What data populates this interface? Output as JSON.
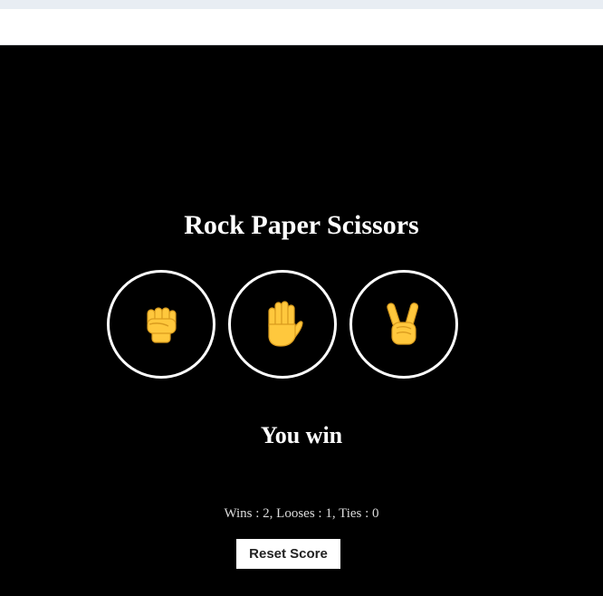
{
  "game": {
    "title": "Rock Paper Scissors",
    "choices": [
      {
        "name": "rock",
        "icon": "raised-fist-icon"
      },
      {
        "name": "paper",
        "icon": "raised-hand-icon"
      },
      {
        "name": "scissors",
        "icon": "victory-hand-icon"
      }
    ],
    "result": "You win",
    "score": {
      "text": "Wins : 2, Looses : 1, Ties : 0",
      "wins": 2,
      "looses": 1,
      "ties": 0
    },
    "reset_label": "Reset Score"
  },
  "colors": {
    "background": "#000000",
    "text": "#ffffff",
    "emoji_skin": "#ffc83d",
    "emoji_outline": "#d99b1e"
  }
}
